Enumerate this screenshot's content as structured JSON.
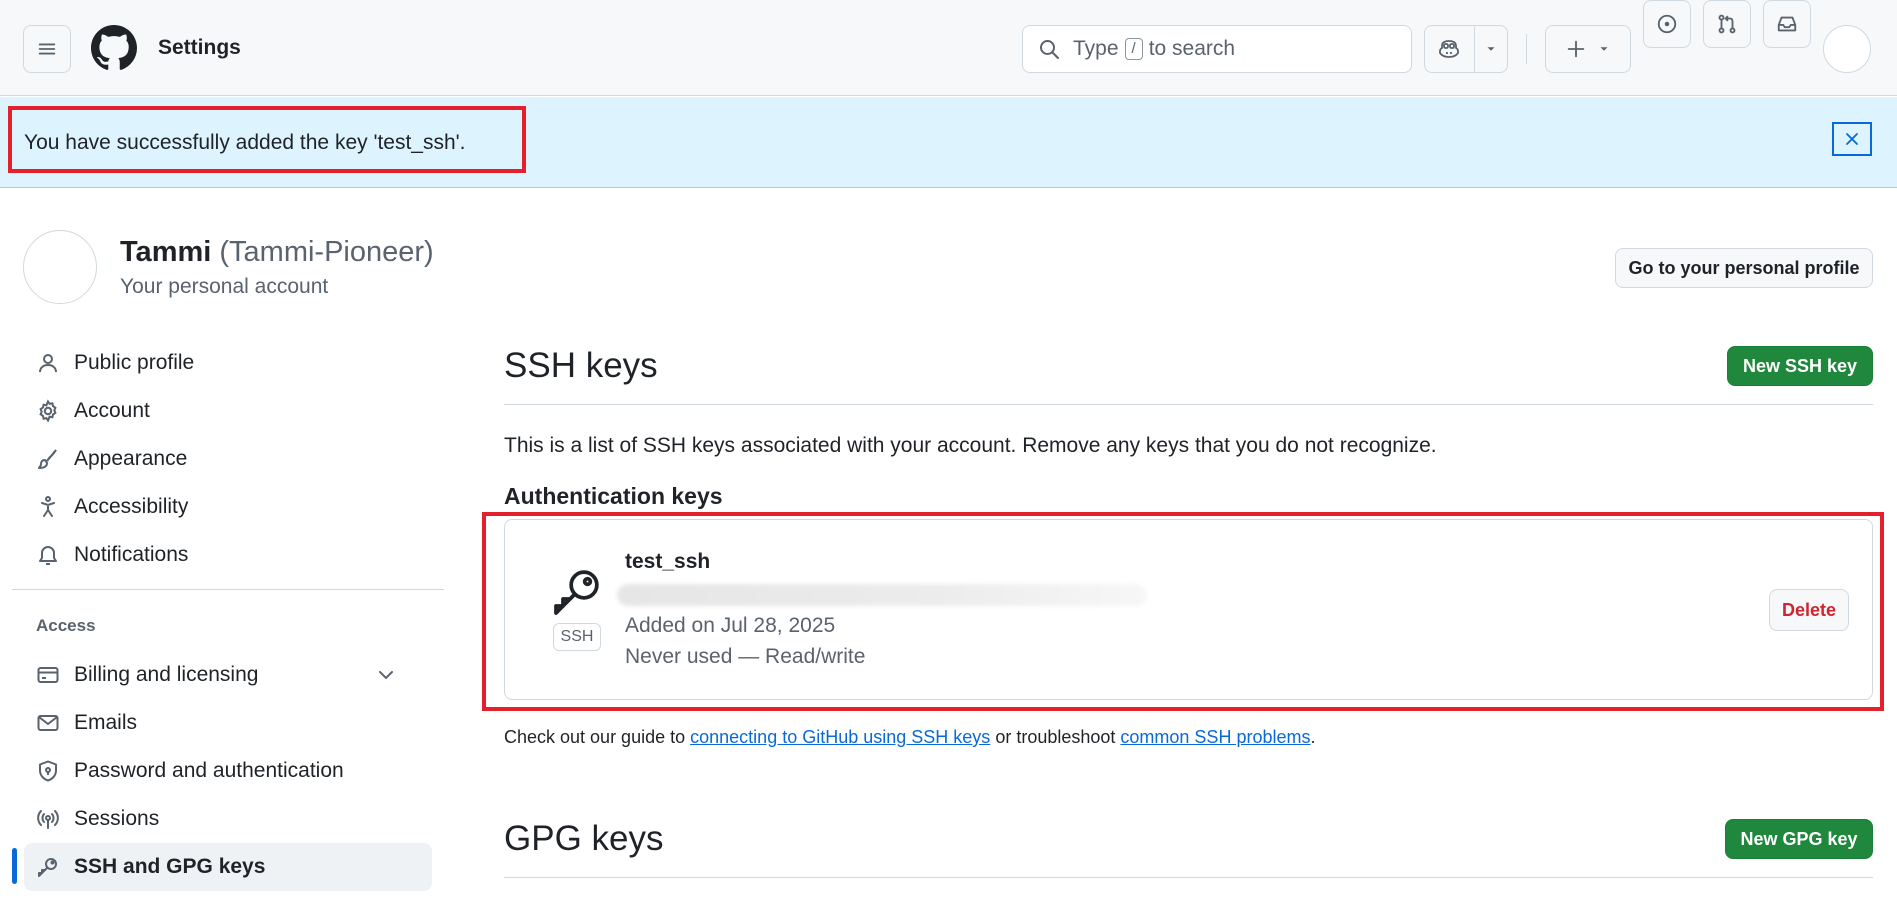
{
  "header": {
    "title": "Settings",
    "search": {
      "prefix": "Type",
      "key": "/",
      "suffix": "to search"
    }
  },
  "flash": {
    "message": "You have successfully added the key 'test_ssh'."
  },
  "profile": {
    "name": "Tammi",
    "login": "(Tammi-Pioneer)",
    "subtitle": "Your personal account",
    "go_profile_label": "Go to your personal profile"
  },
  "sidebar": {
    "items": [
      {
        "label": "Public profile",
        "icon": "person-icon"
      },
      {
        "label": "Account",
        "icon": "gear-icon"
      },
      {
        "label": "Appearance",
        "icon": "paintbrush-icon"
      },
      {
        "label": "Accessibility",
        "icon": "accessibility-icon"
      },
      {
        "label": "Notifications",
        "icon": "bell-icon"
      }
    ],
    "access_heading": "Access",
    "access_items": [
      {
        "label": "Billing and licensing",
        "icon": "credit-card-icon"
      },
      {
        "label": "Emails",
        "icon": "mail-icon"
      },
      {
        "label": "Password and authentication",
        "icon": "shield-lock-icon"
      },
      {
        "label": "Sessions",
        "icon": "broadcast-icon"
      },
      {
        "label": "SSH and GPG keys",
        "icon": "key-icon",
        "active": true
      }
    ]
  },
  "ssh": {
    "title": "SSH keys",
    "new_button": "New SSH key",
    "description": "This is a list of SSH keys associated with your account. Remove any keys that you do not recognize.",
    "auth_heading": "Authentication keys",
    "keys": [
      {
        "title": "test_ssh",
        "type_label": "SSH",
        "added": "Added on Jul 28, 2025",
        "usage": "Never used — Read/write",
        "delete_label": "Delete"
      }
    ],
    "guide": {
      "prefix": "Check out our guide to",
      "link1": "connecting to GitHub using SSH keys",
      "middle": "or troubleshoot",
      "link2": "common SSH problems",
      "suffix": "."
    }
  },
  "gpg": {
    "title": "GPG keys",
    "new_button": "New GPG key"
  },
  "colors": {
    "accent": "#0969da",
    "success": "#1f883d",
    "danger": "#d1242f",
    "highlight": "#e4202c",
    "flash_bg": "#ddf4ff"
  }
}
